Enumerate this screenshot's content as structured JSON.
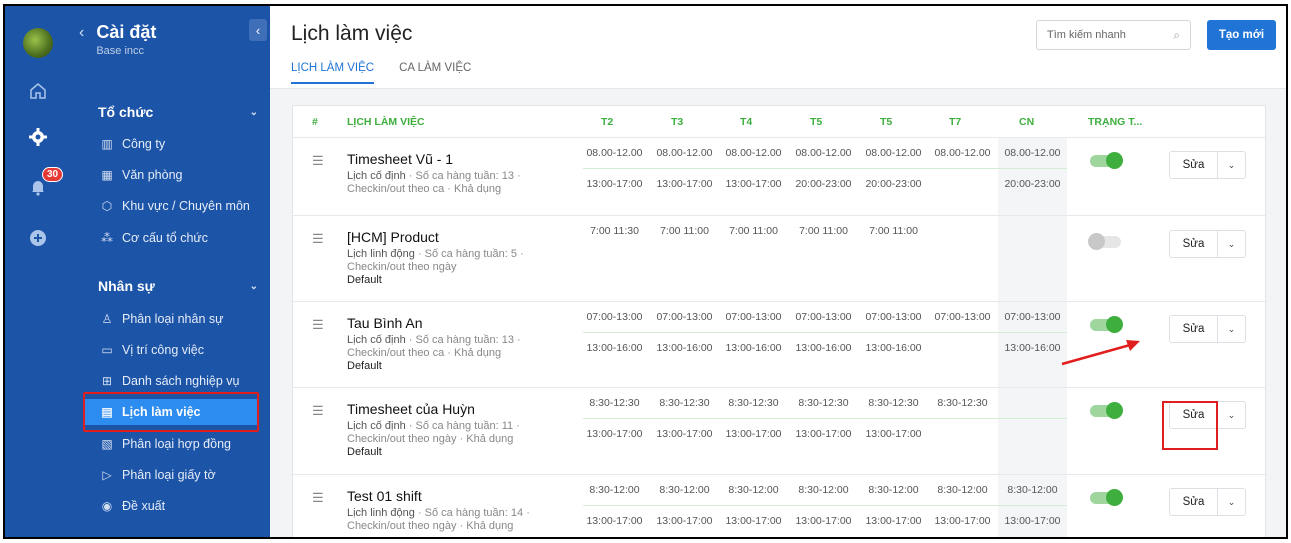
{
  "colors": {
    "sidebar": "#1c54a8",
    "accent": "#1f74d6",
    "green": "#3eaf3e",
    "highlight": "#e01e1e"
  },
  "rail": {
    "badge": "30"
  },
  "sidebar": {
    "title": "Cài đặt",
    "subtitle": "Base incc",
    "sections": [
      {
        "label": "Tổ chức",
        "items": [
          {
            "label": "Công ty",
            "icon": "building-icon"
          },
          {
            "label": "Văn phòng",
            "icon": "office-icon"
          },
          {
            "label": "Khu vực / Chuyên môn",
            "icon": "cube-icon"
          },
          {
            "label": "Cơ cấu tổ chức",
            "icon": "org-chart-icon"
          }
        ]
      },
      {
        "label": "Nhân sự",
        "items": [
          {
            "label": "Phân loại nhân sự",
            "icon": "user-icon"
          },
          {
            "label": "Vị trí công việc",
            "icon": "briefcase-icon"
          },
          {
            "label": "Danh sách nghiệp vụ",
            "icon": "book-icon"
          },
          {
            "label": "Lịch làm việc",
            "icon": "calendar-icon",
            "active": true
          },
          {
            "label": "Phân loại hợp đồng",
            "icon": "contract-icon"
          },
          {
            "label": "Phân loại giấy tờ",
            "icon": "document-icon"
          },
          {
            "label": "Đề xuất",
            "icon": "broadcast-icon"
          }
        ]
      }
    ]
  },
  "header": {
    "title": "Lịch làm việc",
    "tabs": [
      {
        "label": "LỊCH LÀM VIỆC",
        "active": true
      },
      {
        "label": "CA LÀM VIỆC",
        "active": false
      }
    ],
    "search_placeholder": "Tìm kiếm nhanh",
    "new_button": "Tạo mới"
  },
  "table": {
    "columns": [
      "#",
      "LỊCH LÀM VIỆC",
      "T2",
      "T3",
      "T4",
      "T5",
      "T5",
      "T7",
      "CN",
      "TRẠNG T..."
    ],
    "rows": [
      {
        "name": "Timesheet Vũ - 1",
        "type": "Lịch cố định",
        "meta1": " · Số ca hàng tuần: 13 ·",
        "meta2": "Checkin/out theo ca · Khả dụng",
        "meta3": "",
        "shifts": [
          [
            "08.00-12.00",
            "08.00-12.00",
            "08.00-12.00",
            "08.00-12.00",
            "08.00-12.00",
            "08.00-12.00",
            "08.00-12.00"
          ],
          [
            "13:00-17:00",
            "13:00-17:00",
            "13:00-17:00",
            "20:00-23:00",
            "20:00-23:00",
            "",
            "20:00-23:00"
          ]
        ],
        "active": true,
        "edit": "Sửa"
      },
      {
        "name": "[HCM] Product",
        "type": "Lịch linh động",
        "meta1": " · Số ca hàng tuần: 5 ·",
        "meta2": "Checkin/out theo ngày",
        "meta3": "Default",
        "shifts": [
          [
            "7:00 11:30",
            "7:00 11:00",
            "7:00 11:00",
            "7:00 11:00",
            "7:00 11:00",
            "",
            ""
          ]
        ],
        "active": false,
        "edit": "Sửa"
      },
      {
        "name": "Tau Bình An",
        "type": "Lịch cố định",
        "meta1": " · Số ca hàng tuần: 13 ·",
        "meta2": "Checkin/out theo ca · Khả dụng",
        "meta3": "Default",
        "shifts": [
          [
            "07:00-13:00",
            "07:00-13:00",
            "07:00-13:00",
            "07:00-13:00",
            "07:00-13:00",
            "07:00-13:00",
            "07:00-13:00"
          ],
          [
            "13:00-16:00",
            "13:00-16:00",
            "13:00-16:00",
            "13:00-16:00",
            "13:00-16:00",
            "",
            "13:00-16:00"
          ]
        ],
        "active": true,
        "edit": "Sửa"
      },
      {
        "name": "Timesheet của Huỳn",
        "type": "Lịch cố định",
        "meta1": " · Số ca hàng tuần: 11 ·",
        "meta2": "Checkin/out theo ngày · Khả dụng",
        "meta3": "Default",
        "shifts": [
          [
            "8:30-12:30",
            "8:30-12:30",
            "8:30-12:30",
            "8:30-12:30",
            "8:30-12:30",
            "8:30-12:30",
            ""
          ],
          [
            "13:00-17:00",
            "13:00-17:00",
            "13:00-17:00",
            "13:00-17:00",
            "13:00-17:00",
            "",
            ""
          ]
        ],
        "active": true,
        "edit": "Sửa"
      },
      {
        "name": "Test 01 shift",
        "type": "Lịch linh động",
        "meta1": " · Số ca hàng tuần: 14 ·",
        "meta2": "Checkin/out theo ngày · Khả dụng",
        "meta3": "",
        "shifts": [
          [
            "8:30-12:00",
            "8:30-12:00",
            "8:30-12:00",
            "8:30-12:00",
            "8:30-12:00",
            "8:30-12:00",
            "8:30-12:00"
          ],
          [
            "13:00-17:00",
            "13:00-17:00",
            "13:00-17:00",
            "13:00-17:00",
            "13:00-17:00",
            "13:00-17:00",
            "13:00-17:00"
          ]
        ],
        "active": true,
        "edit": "Sửa"
      }
    ]
  }
}
